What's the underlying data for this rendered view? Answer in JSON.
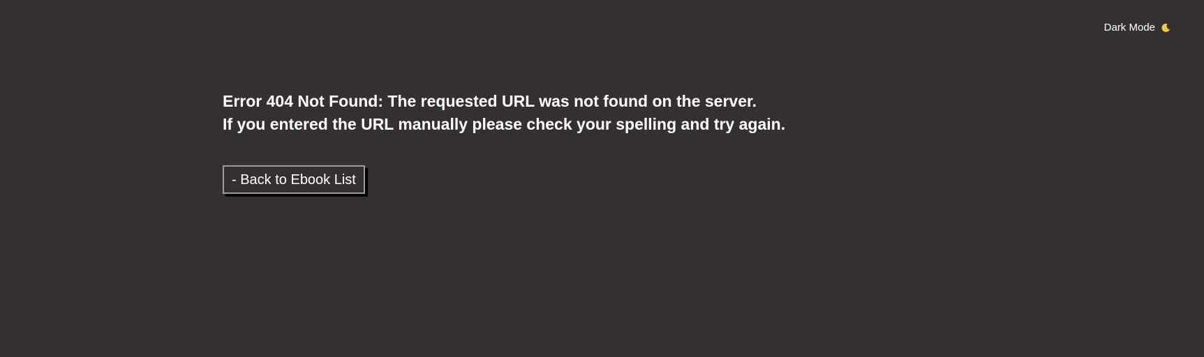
{
  "header": {
    "theme_toggle_label": "Dark Mode",
    "theme_icon": "moon-icon",
    "moon_color": "#f2c744"
  },
  "main": {
    "error_line_1": "Error 404 Not Found: The requested URL was not found on the server.",
    "error_line_2": "If you entered the URL manually please check your spelling and try again.",
    "back_button_label": "- Back to Ebook List"
  },
  "colors": {
    "background": "#353030",
    "text": "#ffffff",
    "button_border": "#a09b9b",
    "button_shadow": "#000000"
  }
}
